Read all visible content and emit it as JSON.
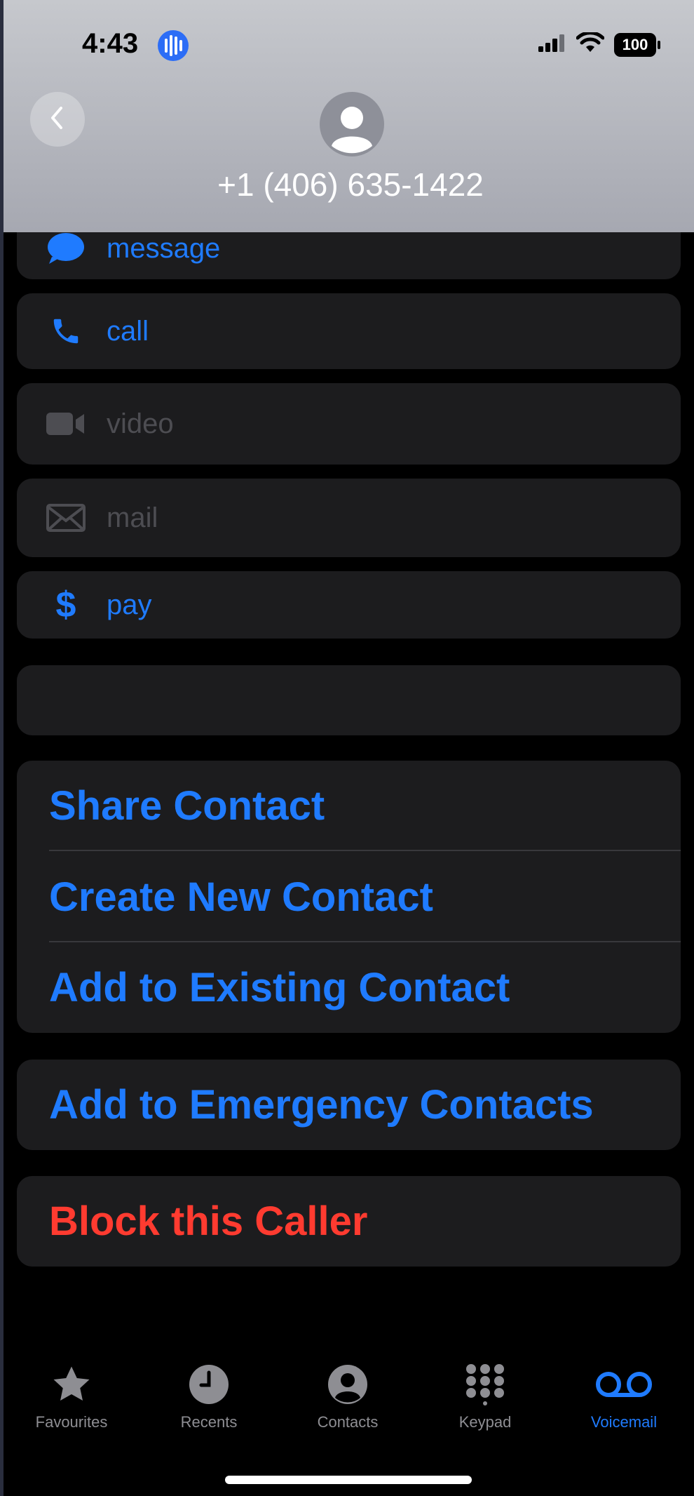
{
  "status_bar": {
    "time": "4:43",
    "battery": "100"
  },
  "header": {
    "phone_number": "+1 (406) 635-1422"
  },
  "actions": [
    {
      "label": "message",
      "icon": "message-icon",
      "enabled": true
    },
    {
      "label": "call",
      "icon": "phone-icon",
      "enabled": true
    },
    {
      "label": "video",
      "icon": "video-icon",
      "enabled": false
    },
    {
      "label": "mail",
      "icon": "mail-icon",
      "enabled": false
    },
    {
      "label": "pay",
      "icon": "dollar-icon",
      "enabled": true
    }
  ],
  "contact_options": {
    "share": "Share Contact",
    "create": "Create New Contact",
    "add_existing": "Add to Existing Contact"
  },
  "emergency": "Add to Emergency Contacts",
  "block": "Block this Caller",
  "tabs": [
    {
      "label": "Favourites",
      "icon": "star-icon",
      "active": false
    },
    {
      "label": "Recents",
      "icon": "clock-icon",
      "active": false
    },
    {
      "label": "Contacts",
      "icon": "person-circle-icon",
      "active": false
    },
    {
      "label": "Keypad",
      "icon": "keypad-icon",
      "active": false
    },
    {
      "label": "Voicemail",
      "icon": "voicemail-icon",
      "active": true
    }
  ],
  "colors": {
    "accent": "#1f7bff",
    "destructive": "#ff3b30",
    "card": "#1c1c1e"
  }
}
